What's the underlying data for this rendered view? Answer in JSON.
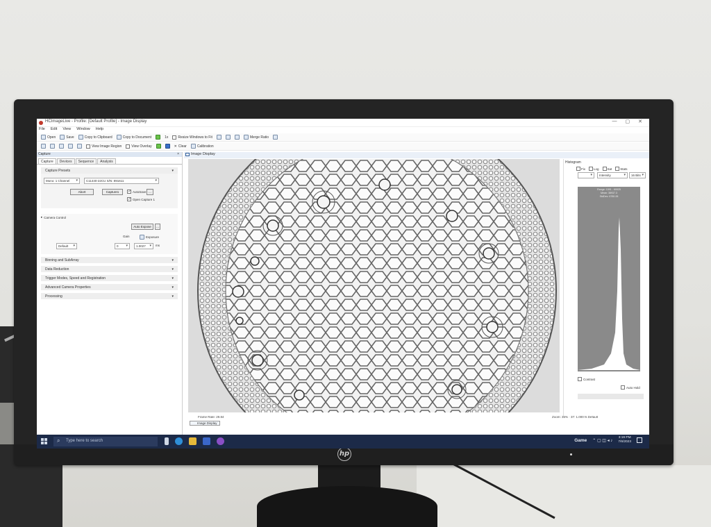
{
  "window": {
    "title": "HCImageLive - Profile: [Default Profile] - Image Display",
    "controls": [
      "—",
      "▢",
      "✕"
    ]
  },
  "menu": [
    "File",
    "Edit",
    "View",
    "Window",
    "Help"
  ],
  "toolbar1": {
    "open": "Open",
    "save": "Save",
    "copy_clipboard": "Copy to Clipboard",
    "copy_document": "Copy to Document",
    "zoom_1x": "1x",
    "resize_windows": "Resize Windows to Fit",
    "merge_ratio": "Merge Ratio"
  },
  "toolbar2": {
    "view_image_region": "View Image Region",
    "view_overlay": "View Overlay",
    "clear": "Clear",
    "calibration": "Calibration"
  },
  "capture_panel": {
    "header": "Capture",
    "close": "×",
    "tabs": [
      "Capture",
      "Devices",
      "Sequence",
      "Analysis"
    ],
    "presets_section": "Capture Presets",
    "channel_mode": "Mono: 1 Channel",
    "camera_device": "C11440-22CU S/N: 891611",
    "abort_button": "Abort",
    "capture_button": "Capture1",
    "autosave_label": "AutoSave",
    "open_capture_label": "Open Capture 1",
    "camera_control": "Camera Control",
    "auto_expose_button": "Auto Expose",
    "more_button": "...",
    "gain_label": "Gain",
    "exposure_label": "Exposure",
    "preset": "Default",
    "gain_value": "0",
    "exposure_value": "1.0027",
    "exposure_unit": "ms",
    "sections": [
      "Binning and SubArray",
      "Data Reduction",
      "Trigger Modes, Speed and Registration",
      "Advanced Camera Properties",
      "Processing"
    ]
  },
  "image_display": {
    "title": "Image Display",
    "frame_rate": "Frame Rate: 29.84",
    "zoom": "Zoom: 35%",
    "position": "37: 1.000 fs Default",
    "tab_label": "Image Display"
  },
  "histogram": {
    "title": "Histogram",
    "options": [
      "Fix",
      "Log",
      "Sat",
      "Stats"
    ],
    "channel": "Intensity",
    "bits": "16 Bits",
    "stats": [
      "Range: 1591 - 60025",
      "Mean: 38937.3",
      "StdDev: 6780.28"
    ],
    "contrast_label": "Contrast",
    "auto_hold_label": "Auto Hold"
  },
  "taskbar": {
    "search_placeholder": "Type here to search",
    "game_label": "Game",
    "time": "3:19 PM",
    "date": "7/6/2023"
  },
  "brand": "hp"
}
